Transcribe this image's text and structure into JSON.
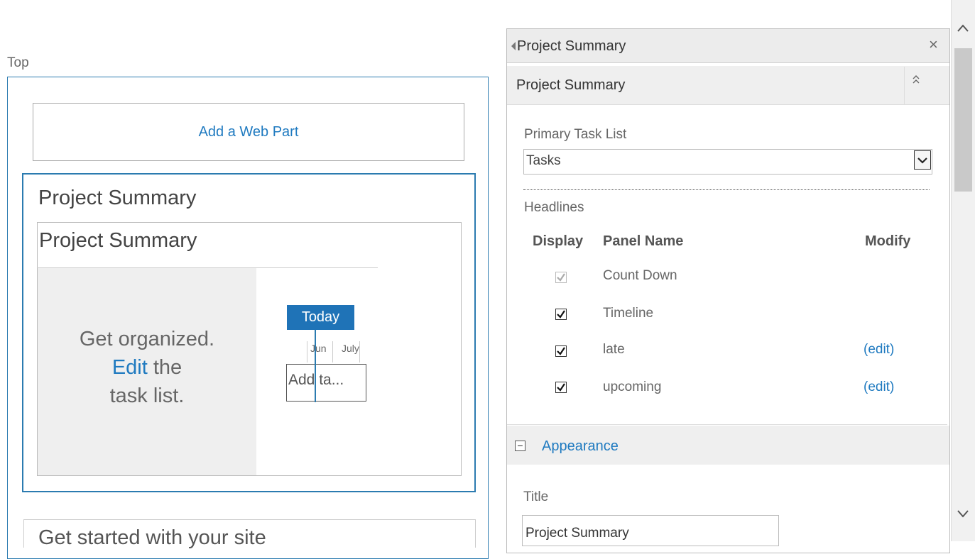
{
  "zone": {
    "label": "Top",
    "add_web_part": "Add a Web Part"
  },
  "webpart": {
    "title": "Project Summary",
    "inner_title": "Project Summary",
    "get_organized": "Get organized.",
    "edit_link": "Edit",
    "edit_suffix": " the",
    "task_list": "task list.",
    "today": "Today",
    "month_jun": "Jun",
    "month_jul": "July",
    "add_task": "Add ta..."
  },
  "next_webpart": {
    "title": "Get started with your site"
  },
  "tool_pane": {
    "title": "Project Summary",
    "close_glyph": "×",
    "section_title": "Project Summary",
    "collapse_glyph": "⌃",
    "primary_task_list_label": "Primary Task List",
    "primary_task_list_value": "Tasks",
    "headlines_label": "Headlines",
    "columns": {
      "display": "Display",
      "panel_name": "Panel Name",
      "modify": "Modify"
    },
    "rows": [
      {
        "name": "Count Down",
        "checked": true,
        "disabled": true,
        "modify": ""
      },
      {
        "name": "Timeline",
        "checked": true,
        "disabled": false,
        "modify": ""
      },
      {
        "name": "late",
        "checked": true,
        "disabled": false,
        "modify": "(edit)"
      },
      {
        "name": "upcoming",
        "checked": true,
        "disabled": false,
        "modify": "(edit)"
      }
    ],
    "appearance_toggle": "−",
    "appearance_label": "Appearance",
    "title_label": "Title",
    "title_value": "Project Summary"
  },
  "icons": {
    "back": "left-triangle-icon",
    "close": "close-icon",
    "collapse": "chevron-up-double-icon",
    "dropdown": "chevron-down-icon",
    "checkbox": "checkmark-icon",
    "scroll_up": "chevron-up-icon",
    "scroll_down": "chevron-down-icon"
  },
  "colors": {
    "accent": "#1f7ac0",
    "zone_border": "#2b7bb0",
    "today_bg": "#1f73b7"
  }
}
